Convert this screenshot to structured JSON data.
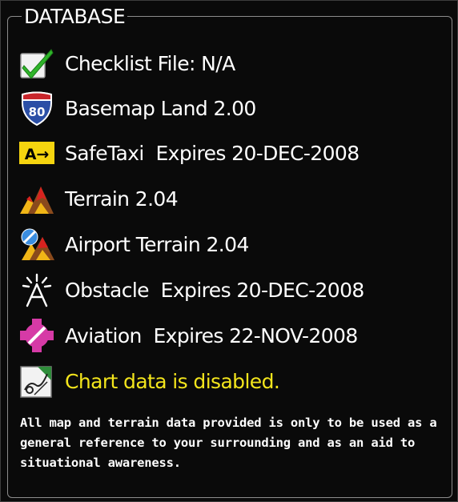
{
  "panel": {
    "title": "DATABASE"
  },
  "databases": [
    {
      "icon": "checkmark-icon",
      "text": "Checklist File: N/A"
    },
    {
      "icon": "interstate-shield-icon",
      "icon_label": "80",
      "text": "Basemap Land 2.00"
    },
    {
      "icon": "safetaxi-icon",
      "icon_label": "A→",
      "text": "SafeTaxi  Expires 20-DEC-2008"
    },
    {
      "icon": "terrain-icon",
      "text": "Terrain 2.04"
    },
    {
      "icon": "airport-terrain-icon",
      "text": "Airport Terrain 2.04"
    },
    {
      "icon": "obstacle-icon",
      "text": "Obstacle  Expires 20-DEC-2008"
    },
    {
      "icon": "aviation-icon",
      "text": "Aviation  Expires 22-NOV-2008"
    },
    {
      "icon": "chart-icon",
      "text": "Chart data is disabled."
    }
  ],
  "disclaimer": "All map and terrain data provided is only to be used as a general reference to your surrounding and as an aid to situational awareness.",
  "colors": {
    "background": "#0a0a0a",
    "text": "#ffffff",
    "warning_text": "#f3e51c",
    "frame": "#8c8c8c"
  }
}
